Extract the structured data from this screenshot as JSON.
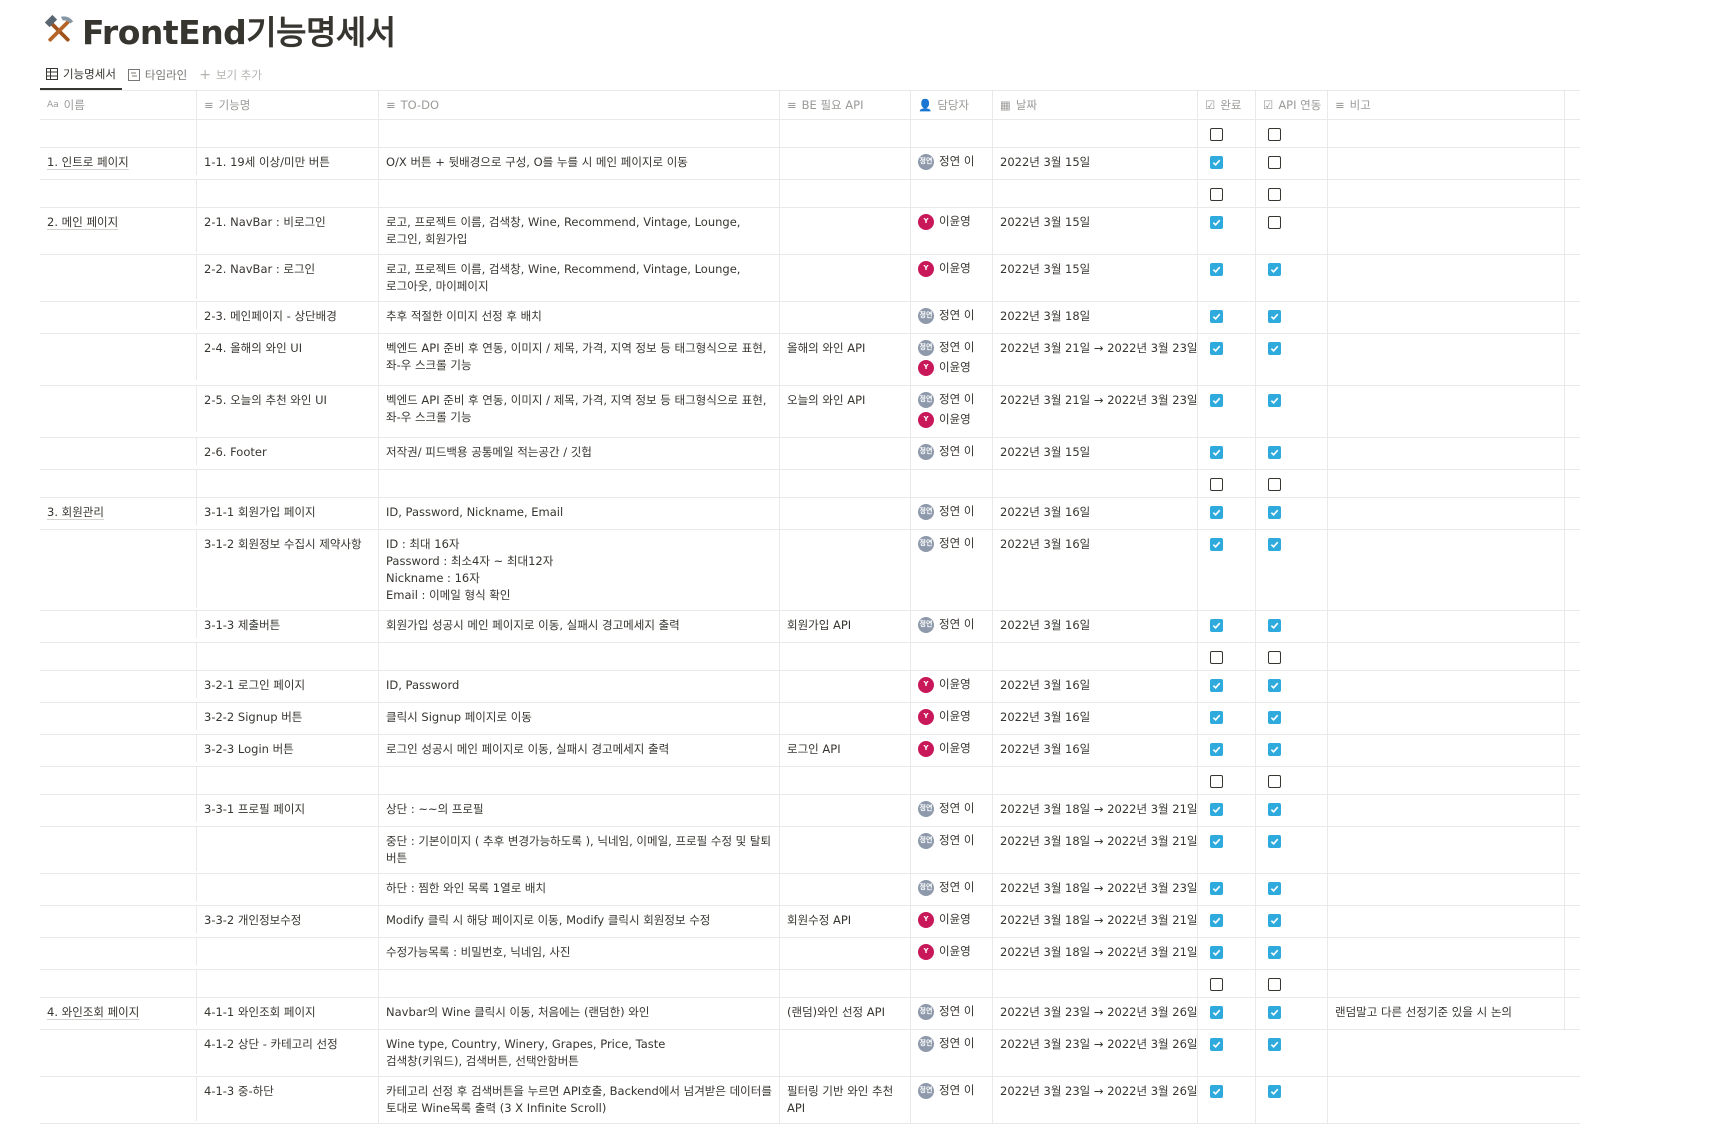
{
  "page": {
    "title": "FrontEnd기능명세서",
    "title_icon": "hammer-and-pick-icon",
    "views": [
      {
        "label": "기능명세서",
        "icon": "table-icon",
        "active": true
      },
      {
        "label": "타임라인",
        "icon": "timeline-icon",
        "active": false
      },
      {
        "label": "보기 추가",
        "icon": "plus-icon",
        "active": false
      }
    ]
  },
  "table": {
    "columns": [
      {
        "label": "이름",
        "icon": "title-aa-icon"
      },
      {
        "label": "기능명",
        "icon": "text-lines-icon"
      },
      {
        "label": "TO-DO",
        "icon": "text-lines-icon"
      },
      {
        "label": "BE 필요 API",
        "icon": "text-lines-icon"
      },
      {
        "label": "담당자",
        "icon": "person-icon"
      },
      {
        "label": "날짜",
        "icon": "calendar-icon"
      },
      {
        "label": "완료",
        "icon": "checkbox-icon"
      },
      {
        "label": "API 연동",
        "icon": "checkbox-icon"
      },
      {
        "label": "비고",
        "icon": "text-lines-icon"
      }
    ],
    "rows": [
      {
        "name": "",
        "feature": "",
        "todo": "",
        "api": "",
        "people": [],
        "date": "",
        "done": false,
        "api_done": false,
        "note": ""
      },
      {
        "name": "1. 인트로 페이지",
        "feature": "1-1. 19세 이상/미만 버튼",
        "todo": "O/X 버튼 + 뒷배경으로 구성, O를 누를 시 메인 페이지로 이동",
        "api": "",
        "people": [
          {
            "initial": "정연",
            "name": "정연 이",
            "color": "gray"
          }
        ],
        "date": "2022년 3월 15일",
        "done": true,
        "api_done": false,
        "note": ""
      },
      {
        "name": "",
        "feature": "",
        "todo": "",
        "api": "",
        "people": [],
        "date": "",
        "done": false,
        "api_done": false,
        "note": ""
      },
      {
        "name": "2. 메인 페이지",
        "feature": "2-1. NavBar : 비로그인",
        "todo": "로고, 프로젝트 이름, 검색창, Wine, Recommend, Vintage, Lounge, 로그인, 회원가입",
        "api": "",
        "people": [
          {
            "initial": "Y",
            "name": "이윤영",
            "color": "red"
          }
        ],
        "date": "2022년 3월 15일",
        "done": true,
        "api_done": false,
        "note": ""
      },
      {
        "name": "",
        "feature": "2-2. NavBar : 로그인",
        "todo": "로고, 프로젝트 이름, 검색창, Wine, Recommend, Vintage, Lounge, 로그아웃, 마이페이지",
        "api": "",
        "people": [
          {
            "initial": "Y",
            "name": "이윤영",
            "color": "red"
          }
        ],
        "date": "2022년 3월 15일",
        "done": true,
        "api_done": true,
        "note": ""
      },
      {
        "name": "",
        "feature": "2-3. 메인페이지 - 상단배경",
        "todo": "추후 적절한 이미지 선정 후 배치",
        "api": "",
        "people": [
          {
            "initial": "정연",
            "name": "정연 이",
            "color": "gray"
          }
        ],
        "date": "2022년 3월 18일",
        "done": true,
        "api_done": true,
        "note": ""
      },
      {
        "name": "",
        "feature": "2-4. 올해의 와인 UI",
        "todo": "벡엔드 API 준비 후 연동, 이미지 / 제목, 가격, 지역 정보 등 태그형식으로 표현, 좌-우 스크롤 기능",
        "api": "올해의 와인 API",
        "people": [
          {
            "initial": "정연",
            "name": "정연 이",
            "color": "gray"
          },
          {
            "initial": "Y",
            "name": "이윤영",
            "color": "red"
          }
        ],
        "date": "2022년 3월 21일 → 2022년 3월 23일",
        "done": true,
        "api_done": true,
        "note": ""
      },
      {
        "name": "",
        "feature": "2-5. 오늘의 추천 와인 UI",
        "todo": "벡엔드 API 준비 후 연동, 이미지 / 제목, 가격, 지역 정보 등 태그형식으로 표현, 좌-우 스크롤 기능",
        "api": "오늘의 와인 API",
        "people": [
          {
            "initial": "정연",
            "name": "정연 이",
            "color": "gray"
          },
          {
            "initial": "Y",
            "name": "이윤영",
            "color": "red"
          }
        ],
        "date": "2022년 3월 21일 → 2022년 3월 23일",
        "done": true,
        "api_done": true,
        "note": ""
      },
      {
        "name": "",
        "feature": "2-6. Footer",
        "todo": "저작권/ 피드백용 공통메일 적는공간 / 깃헙",
        "api": "",
        "people": [
          {
            "initial": "정연",
            "name": "정연 이",
            "color": "gray"
          }
        ],
        "date": "2022년 3월 15일",
        "done": true,
        "api_done": true,
        "note": ""
      },
      {
        "name": "",
        "feature": "",
        "todo": "",
        "api": "",
        "people": [],
        "date": "",
        "done": false,
        "api_done": false,
        "note": ""
      },
      {
        "name": "3. 회원관리",
        "feature": "3-1-1 회원가입 페이지",
        "todo": "ID, Password, Nickname, Email",
        "api": "",
        "people": [
          {
            "initial": "정연",
            "name": "정연 이",
            "color": "gray"
          }
        ],
        "date": "2022년 3월 16일",
        "done": true,
        "api_done": true,
        "note": ""
      },
      {
        "name": "",
        "feature": "3-1-2 회원정보 수집시 제약사항",
        "todo": "ID : 최대 16자\nPassword : 최소4자 ~ 최대12자\nNickname : 16자\nEmail : 이메일 형식 확인",
        "api": "",
        "people": [
          {
            "initial": "정연",
            "name": "정연 이",
            "color": "gray"
          }
        ],
        "date": "2022년 3월 16일",
        "done": true,
        "api_done": true,
        "note": ""
      },
      {
        "name": "",
        "feature": "3-1-3 제출버튼",
        "todo": "회원가입 성공시 메인 페이지로 이동, 실패시 경고메세지 출력",
        "api": "회원가입 API",
        "people": [
          {
            "initial": "정연",
            "name": "정연 이",
            "color": "gray"
          }
        ],
        "date": "2022년 3월 16일",
        "done": true,
        "api_done": true,
        "note": ""
      },
      {
        "name": "",
        "feature": "",
        "todo": "",
        "api": "",
        "people": [],
        "date": "",
        "done": false,
        "api_done": false,
        "note": ""
      },
      {
        "name": "",
        "feature": "3-2-1 로그인 페이지",
        "todo": "ID, Password",
        "api": "",
        "people": [
          {
            "initial": "Y",
            "name": "이윤영",
            "color": "red"
          }
        ],
        "date": "2022년 3월 16일",
        "done": true,
        "api_done": true,
        "note": ""
      },
      {
        "name": "",
        "feature": "3-2-2 Signup 버튼",
        "todo": "클릭시 Signup 페이지로 이동",
        "api": "",
        "people": [
          {
            "initial": "Y",
            "name": "이윤영",
            "color": "red"
          }
        ],
        "date": "2022년 3월 16일",
        "done": true,
        "api_done": true,
        "note": ""
      },
      {
        "name": "",
        "feature": "3-2-3 Login 버튼",
        "todo": "로그인 성공시 메인 페이지로 이동, 실패시 경고메세지 출력",
        "api": "로그인 API",
        "people": [
          {
            "initial": "Y",
            "name": "이윤영",
            "color": "red"
          }
        ],
        "date": "2022년 3월 16일",
        "done": true,
        "api_done": true,
        "note": ""
      },
      {
        "name": "",
        "feature": "",
        "todo": "",
        "api": "",
        "people": [],
        "date": "",
        "done": false,
        "api_done": false,
        "note": ""
      },
      {
        "name": "",
        "feature": "3-3-1 프로필 페이지",
        "todo": "상단 : ~~의 프로필",
        "api": "",
        "people": [
          {
            "initial": "정연",
            "name": "정연 이",
            "color": "gray"
          }
        ],
        "date": "2022년 3월 18일 → 2022년 3월 21일",
        "done": true,
        "api_done": true,
        "note": ""
      },
      {
        "name": "",
        "feature": "",
        "todo": "중단 : 기본이미지 ( 추후 변경가능하도록 ),  닉네임, 이메일, 프로필 수정 및 탈퇴 버튼",
        "api": "",
        "people": [
          {
            "initial": "정연",
            "name": "정연 이",
            "color": "gray"
          }
        ],
        "date": "2022년 3월 18일 → 2022년 3월 21일",
        "done": true,
        "api_done": true,
        "note": ""
      },
      {
        "name": "",
        "feature": "",
        "todo": "하단 : 찜한 와인 목록 1열로 배치",
        "api": "",
        "people": [
          {
            "initial": "정연",
            "name": "정연 이",
            "color": "gray"
          }
        ],
        "date": "2022년 3월 18일 → 2022년 3월 23일",
        "done": true,
        "api_done": true,
        "note": ""
      },
      {
        "name": "",
        "feature": "3-3-2 개인정보수정",
        "todo": "Modify 클릭 시 해당 페이지로 이동, Modify 클릭시 회원정보 수정",
        "api": "회원수정 API",
        "people": [
          {
            "initial": "Y",
            "name": "이윤영",
            "color": "red"
          }
        ],
        "date": "2022년 3월 18일 → 2022년 3월 21일",
        "done": true,
        "api_done": true,
        "note": ""
      },
      {
        "name": "",
        "feature": "",
        "todo": "수정가능목록 : 비밀번호, 닉네임, 사진",
        "api": "",
        "people": [
          {
            "initial": "Y",
            "name": "이윤영",
            "color": "red"
          }
        ],
        "date": "2022년 3월 18일 → 2022년 3월 21일",
        "done": true,
        "api_done": true,
        "note": ""
      },
      {
        "name": "",
        "feature": "",
        "todo": "",
        "api": "",
        "people": [],
        "date": "",
        "done": false,
        "api_done": false,
        "note": ""
      },
      {
        "name": "4. 와인조회 페이지",
        "feature": "4-1-1 와인조회 페이지",
        "todo": "Navbar의 Wine 클릭시 이동, 처음에는 (랜덤한) 와인",
        "api": "(랜덤)와인 선정 API",
        "people": [
          {
            "initial": "정연",
            "name": "정연 이",
            "color": "gray"
          }
        ],
        "date": "2022년 3월 23일 → 2022년 3월 26일",
        "done": true,
        "api_done": true,
        "note": "랜덤말고 다른 선정기준 있을 시 논의"
      },
      {
        "name": "",
        "feature": "4-1-2 상단 - 카테고리 선정",
        "todo": "Wine type, Country, Winery, Grapes, Price, Taste\n검색창(키워드), 검색버튼, 선택안함버튼",
        "api": "",
        "people": [
          {
            "initial": "정연",
            "name": "정연 이",
            "color": "gray"
          }
        ],
        "date": "2022년 3월 23일 → 2022년 3월 26일",
        "done": true,
        "api_done": true,
        "note": ""
      },
      {
        "name": "",
        "feature": "4-1-3 중-하단",
        "todo": "카테고리 선정 후 검색버튼을 누르면 API호출, Backend에서 넘겨받은 데이터를 토대로 Wine목록 출력 (3 X Infinite Scroll)",
        "api": "필터링 기반 와인 추천 API",
        "people": [
          {
            "initial": "정연",
            "name": "정연 이",
            "color": "gray"
          }
        ],
        "date": "2022년 3월 23일 → 2022년 3월 26일",
        "done": true,
        "api_done": true,
        "note": ""
      }
    ]
  }
}
